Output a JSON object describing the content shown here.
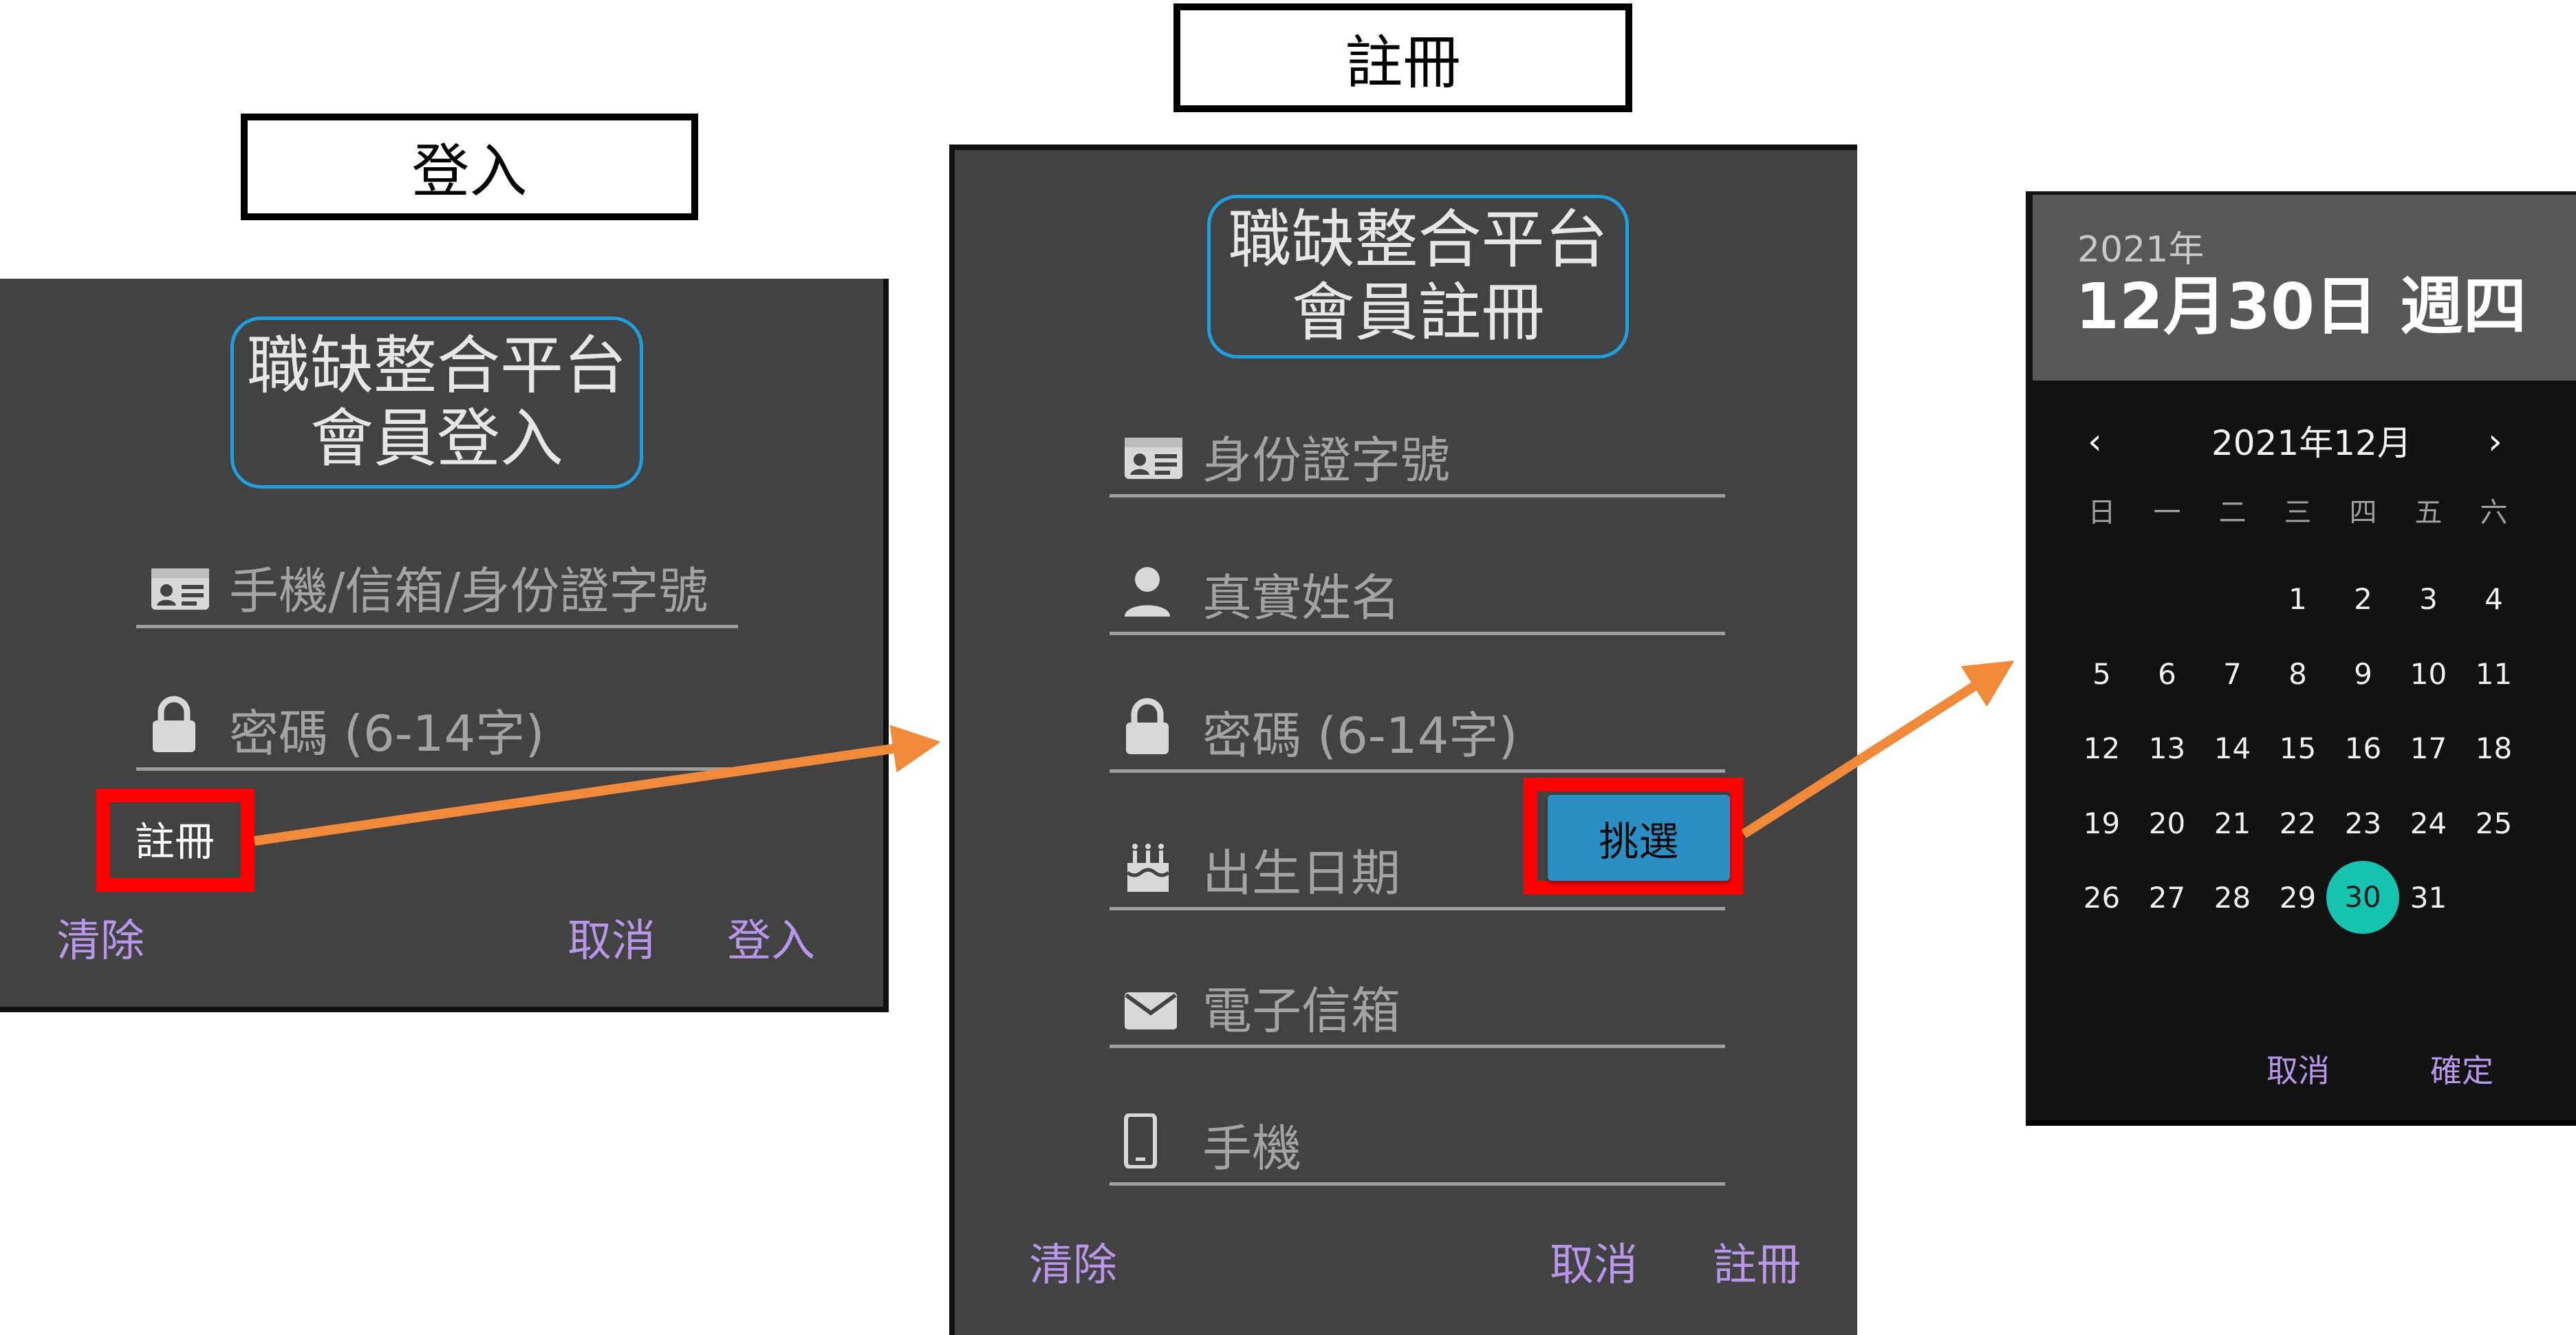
{
  "sections": {
    "login_title": "登入",
    "register_title": "註冊"
  },
  "login": {
    "brand_line1": "職缺整合平台",
    "brand_line2": "會員登入",
    "account_placeholder": "手機/信箱/身份證字號",
    "password_placeholder": "密碼 (6-14字)",
    "register_link": "註冊",
    "clear_label": "清除",
    "cancel_label": "取消",
    "login_label": "登入"
  },
  "register": {
    "brand_line1": "職缺整合平台",
    "brand_line2": "會員註冊",
    "id_placeholder": "身份證字號",
    "name_placeholder": "真實姓名",
    "password_placeholder": "密碼 (6-14字)",
    "birthday_placeholder": "出生日期",
    "pick_label": "挑選",
    "email_placeholder": "電子信箱",
    "phone_placeholder": "手機",
    "clear_label": "清除",
    "cancel_label": "取消",
    "register_label": "註冊"
  },
  "datepicker": {
    "header_year": "2021年",
    "header_date": "12月30日 週四",
    "month_label": "2021年12月",
    "prev_icon": "‹",
    "next_icon": "›",
    "weekdays": [
      "日",
      "一",
      "二",
      "三",
      "四",
      "五",
      "六"
    ],
    "first_weekday_index": 3,
    "days_in_month": 31,
    "selected_day": 30,
    "cancel_label": "取消",
    "ok_label": "確定"
  },
  "colors": {
    "panel_bg": "#424242",
    "brand_border": "#1f9ee0",
    "action_text": "#b996ea",
    "highlight_box": "#ff0000",
    "arrow": "#f08a3a",
    "pick_button": "#2a8fc4",
    "selected_day": "#16c2b0"
  },
  "icons": {
    "account": "id-card-icon",
    "password": "lock-icon",
    "name": "person-icon",
    "birthday": "cake-icon",
    "email": "envelope-icon",
    "phone": "smartphone-icon"
  }
}
